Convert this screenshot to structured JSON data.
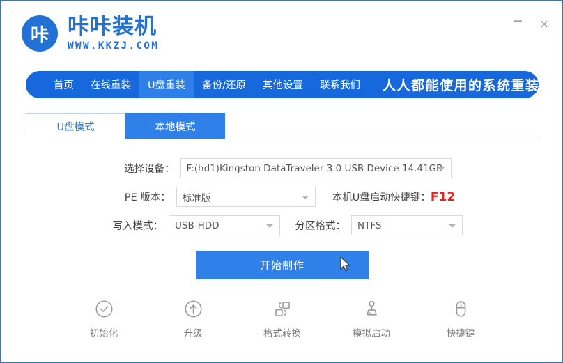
{
  "window": {
    "title": "咔咔装机",
    "minimize_label": "−",
    "close_label": "×"
  },
  "brand": {
    "mark_char": "咔",
    "title": "咔咔装机",
    "subtitle": "WWW.KKZJ.COM"
  },
  "nav": {
    "items": [
      {
        "label": "首页",
        "active": false
      },
      {
        "label": "在线重装",
        "active": false
      },
      {
        "label": "U盘重装",
        "active": true
      },
      {
        "label": "备份/还原",
        "active": false
      },
      {
        "label": "其他设置",
        "active": false
      },
      {
        "label": "联系我们",
        "active": false
      }
    ],
    "slogan": "人人都能使用的系统重装工具",
    "bar_color": "#1668dc",
    "active_color": "#2f7fe8"
  },
  "tabs": [
    {
      "label": "U盘模式",
      "active": true
    },
    {
      "label": "本地模式",
      "active": false
    }
  ],
  "form": {
    "device": {
      "label": "选择设备：",
      "value": "F:(hd1)Kingston DataTraveler 3.0 USB Device 14.41GB"
    },
    "pe_version": {
      "label": "PE 版本：",
      "value": "标准版"
    },
    "hotkey": {
      "label": "本机U盘启动快捷键：",
      "key": "F12",
      "key_color": "#e8221e"
    },
    "write_mode": {
      "label": "写入模式：",
      "value": "USB-HDD"
    },
    "partition_format": {
      "label": "分区格式：",
      "value": "NTFS"
    }
  },
  "actions": {
    "start_label": "开始制作",
    "start_color": "#2f80e8"
  },
  "footer": {
    "items": [
      {
        "icon": "check-circle-icon",
        "label": "初始化"
      },
      {
        "icon": "upgrade-arrow-circle-icon",
        "label": "升级"
      },
      {
        "icon": "format-convert-icon",
        "label": "格式转换"
      },
      {
        "icon": "joystick-icon",
        "label": "模拟启动"
      },
      {
        "icon": "mouse-icon",
        "label": "快捷键"
      }
    ]
  }
}
